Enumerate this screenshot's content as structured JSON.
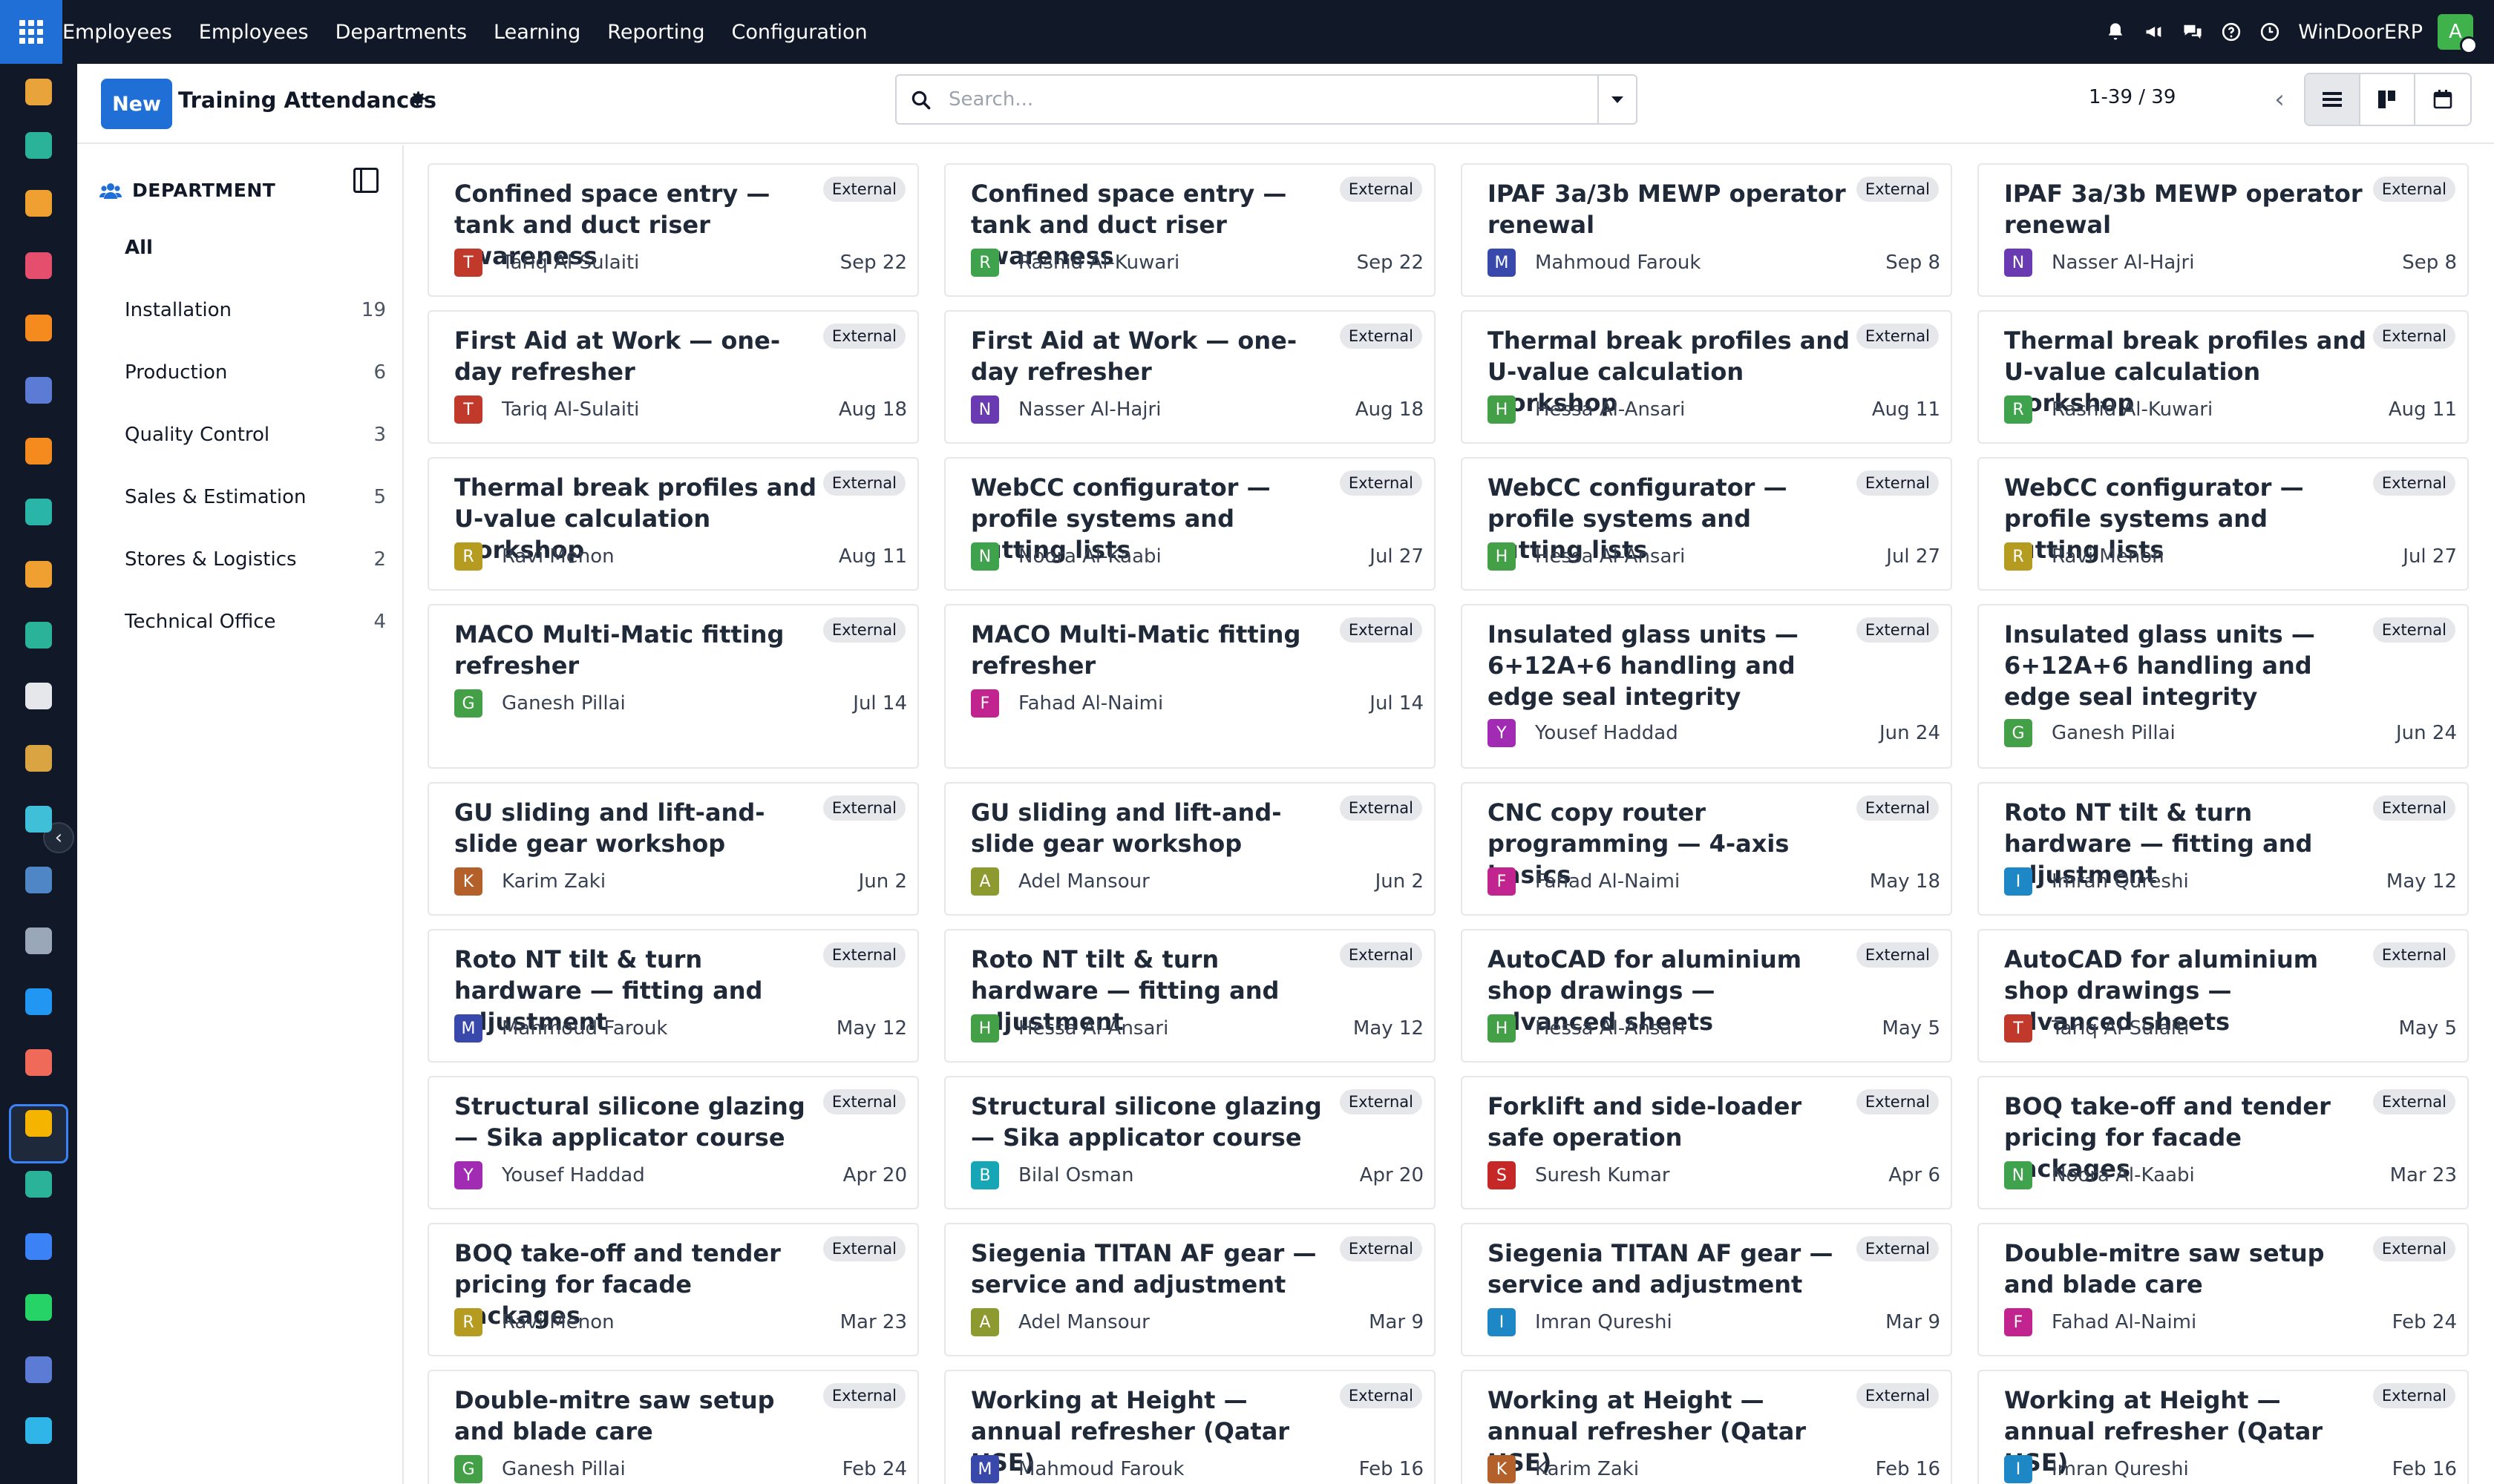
{
  "nav": {
    "brand": "Employees",
    "menu": [
      "Employees",
      "Departments",
      "Learning",
      "Reporting",
      "Configuration"
    ],
    "company": "WinDoorERP",
    "user_initial": "A"
  },
  "control": {
    "new_label": "New",
    "title": "Training Attendances",
    "search_placeholder": "Search...",
    "pager": "1-39 / 39"
  },
  "sidebar": {
    "header": "DEPARTMENT",
    "items": [
      {
        "label": "All",
        "count": ""
      },
      {
        "label": "Installation",
        "count": "19"
      },
      {
        "label": "Production",
        "count": "6"
      },
      {
        "label": "Quality Control",
        "count": "3"
      },
      {
        "label": "Sales & Estimation",
        "count": "5"
      },
      {
        "label": "Stores & Logistics",
        "count": "2"
      },
      {
        "label": "Technical Office",
        "count": "4"
      }
    ]
  },
  "badge_label": "External",
  "cards": [
    {
      "title": "Confined space entry — tank and duct riser awareness",
      "employee": "Tariq Al-Sulaiti",
      "initial": "T",
      "color": "#c0392b",
      "date": "Sep 22"
    },
    {
      "title": "Confined space entry — tank and duct riser awareness",
      "employee": "Rashid Al-Kuwari",
      "initial": "R",
      "color": "#3fa34d",
      "date": "Sep 22"
    },
    {
      "title": "IPAF 3a/3b MEWP operator renewal",
      "employee": "Mahmoud Farouk",
      "initial": "M",
      "color": "#3949ab",
      "date": "Sep 8"
    },
    {
      "title": "IPAF 3a/3b MEWP operator renewal",
      "employee": "Nasser Al-Hajri",
      "initial": "N",
      "color": "#6a3ab2",
      "date": "Sep 8"
    },
    {
      "title": "First Aid at Work — one-day refresher",
      "employee": "Tariq Al-Sulaiti",
      "initial": "T",
      "color": "#c0392b",
      "date": "Aug 18"
    },
    {
      "title": "First Aid at Work — one-day refresher",
      "employee": "Nasser Al-Hajri",
      "initial": "N",
      "color": "#6a3ab2",
      "date": "Aug 18"
    },
    {
      "title": "Thermal break profiles and U-value calculation workshop",
      "employee": "Hessa Al-Ansari",
      "initial": "H",
      "color": "#43a047",
      "date": "Aug 11"
    },
    {
      "title": "Thermal break profiles and U-value calculation workshop",
      "employee": "Rashid Al-Kuwari",
      "initial": "R",
      "color": "#3fa34d",
      "date": "Aug 11"
    },
    {
      "title": "Thermal break profiles and U-value calculation workshop",
      "employee": "Ravi Menon",
      "initial": "R",
      "color": "#b59b1f",
      "date": "Aug 11"
    },
    {
      "title": "WebCC configurator — profile systems and cutting lists",
      "employee": "Noora Al-Kaabi",
      "initial": "N",
      "color": "#3fa34d",
      "date": "Jul 27"
    },
    {
      "title": "WebCC configurator — profile systems and cutting lists",
      "employee": "Hessa Al-Ansari",
      "initial": "H",
      "color": "#43a047",
      "date": "Jul 27"
    },
    {
      "title": "WebCC configurator — profile systems and cutting lists",
      "employee": "Ravi Menon",
      "initial": "R",
      "color": "#b59b1f",
      "date": "Jul 27"
    },
    {
      "title": "MACO Multi-Matic fitting refresher",
      "employee": "Ganesh Pillai",
      "initial": "G",
      "color": "#43a047",
      "date": "Jul 14"
    },
    {
      "title": "MACO Multi-Matic fitting refresher",
      "employee": "Fahad Al-Naimi",
      "initial": "F",
      "color": "#c2248f",
      "date": "Jul 14"
    },
    {
      "title": "Insulated glass units — 6+12A+6 handling and edge seal integrity",
      "employee": "Yousef Haddad",
      "initial": "Y",
      "color": "#a12bb3",
      "date": "Jun 24"
    },
    {
      "title": "Insulated glass units — 6+12A+6 handling and edge seal integrity",
      "employee": "Ganesh Pillai",
      "initial": "G",
      "color": "#43a047",
      "date": "Jun 24"
    },
    {
      "title": "GU sliding and lift-and-slide gear workshop",
      "employee": "Karim Zaki",
      "initial": "K",
      "color": "#b3602b",
      "date": "Jun 2"
    },
    {
      "title": "GU sliding and lift-and-slide gear workshop",
      "employee": "Adel Mansour",
      "initial": "A",
      "color": "#8c9a2f",
      "date": "Jun 2"
    },
    {
      "title": "CNC copy router programming — 4-axis basics",
      "employee": "Fahad Al-Naimi",
      "initial": "F",
      "color": "#c2248f",
      "date": "May 18"
    },
    {
      "title": "Roto NT tilt & turn hardware — fitting and adjustment",
      "employee": "Imran Qureshi",
      "initial": "I",
      "color": "#1e88c7",
      "date": "May 12"
    },
    {
      "title": "Roto NT tilt & turn hardware — fitting and adjustment",
      "employee": "Mahmoud Farouk",
      "initial": "M",
      "color": "#3949ab",
      "date": "May 12"
    },
    {
      "title": "Roto NT tilt & turn hardware — fitting and adjustment",
      "employee": "Hessa Al-Ansari",
      "initial": "H",
      "color": "#43a047",
      "date": "May 12"
    },
    {
      "title": "AutoCAD for aluminium shop drawings — advanced sheets",
      "employee": "Hessa Al-Ansari",
      "initial": "H",
      "color": "#43a047",
      "date": "May 5"
    },
    {
      "title": "AutoCAD for aluminium shop drawings — advanced sheets",
      "employee": "Tariq Al-Sulaiti",
      "initial": "T",
      "color": "#c0392b",
      "date": "May 5"
    },
    {
      "title": "Structural silicone glazing — Sika applicator course",
      "employee": "Yousef Haddad",
      "initial": "Y",
      "color": "#a12bb3",
      "date": "Apr 20"
    },
    {
      "title": "Structural silicone glazing — Sika applicator course",
      "employee": "Bilal Osman",
      "initial": "B",
      "color": "#17a6b5",
      "date": "Apr 20"
    },
    {
      "title": "Forklift and side-loader safe operation",
      "employee": "Suresh Kumar",
      "initial": "S",
      "color": "#c62828",
      "date": "Apr 6"
    },
    {
      "title": "BOQ take-off and tender pricing for facade packages",
      "employee": "Noora Al-Kaabi",
      "initial": "N",
      "color": "#3fa34d",
      "date": "Mar 23"
    },
    {
      "title": "BOQ take-off and tender pricing for facade packages",
      "employee": "Ravi Menon",
      "initial": "R",
      "color": "#b59b1f",
      "date": "Mar 23"
    },
    {
      "title": "Siegenia TITAN AF gear — service and adjustment",
      "employee": "Adel Mansour",
      "initial": "A",
      "color": "#8c9a2f",
      "date": "Mar 9"
    },
    {
      "title": "Siegenia TITAN AF gear — service and adjustment",
      "employee": "Imran Qureshi",
      "initial": "I",
      "color": "#1e88c7",
      "date": "Mar 9"
    },
    {
      "title": "Double-mitre saw setup and blade care",
      "employee": "Fahad Al-Naimi",
      "initial": "F",
      "color": "#c2248f",
      "date": "Feb 24"
    },
    {
      "title": "Double-mitre saw setup and blade care",
      "employee": "Ganesh Pillai",
      "initial": "G",
      "color": "#43a047",
      "date": "Feb 24"
    },
    {
      "title": "Working at Height — annual refresher (Qatar HSE)",
      "employee": "Mahmoud Farouk",
      "initial": "M",
      "color": "#3949ab",
      "date": "Feb 16"
    },
    {
      "title": "Working at Height — annual refresher (Qatar HSE)",
      "employee": "Karim Zaki",
      "initial": "K",
      "color": "#b3602b",
      "date": "Feb 16"
    },
    {
      "title": "Working at Height — annual refresher (Qatar HSE)",
      "employee": "Imran Qureshi",
      "initial": "I",
      "color": "#1e88c7",
      "date": "Feb 16"
    }
  ],
  "rail_icons": [
    {
      "name": "app-icon-1",
      "color": "#e8a33a"
    },
    {
      "name": "app-icon-2",
      "color": "#2bb39a"
    },
    {
      "name": "app-icon-3",
      "color": "#f0a030"
    },
    {
      "name": "app-icon-4",
      "color": "#e54f6d"
    },
    {
      "name": "app-icon-5",
      "color": "#f58a1f"
    },
    {
      "name": "app-icon-6",
      "color": "#5b7bd5"
    },
    {
      "name": "app-icon-7",
      "color": "#f58a1f"
    },
    {
      "name": "app-icon-8",
      "color": "#29b6a8"
    },
    {
      "name": "app-icon-9",
      "color": "#f0a030"
    },
    {
      "name": "app-icon-10",
      "color": "#2bb39a"
    },
    {
      "name": "app-icon-11",
      "color": "#e5e7eb"
    },
    {
      "name": "app-icon-12",
      "color": "#d9a441"
    },
    {
      "name": "app-icon-13",
      "color": "#3fbfd8"
    },
    {
      "name": "app-icon-14",
      "color": "#4f86c6"
    },
    {
      "name": "app-icon-15",
      "color": "#9aa7b8"
    },
    {
      "name": "app-icon-16",
      "color": "#2196f3"
    },
    {
      "name": "app-icon-employees",
      "color": "#f06a5a"
    },
    {
      "name": "app-icon-17",
      "color": "#f5b400"
    },
    {
      "name": "app-icon-18",
      "color": "#2bb39a"
    },
    {
      "name": "app-icon-19",
      "color": "#3b82f6"
    },
    {
      "name": "app-icon-20",
      "color": "#25d366"
    },
    {
      "name": "app-icon-21",
      "color": "#5b7bd5"
    },
    {
      "name": "app-icon-22",
      "color": "#2fb5e8"
    }
  ]
}
